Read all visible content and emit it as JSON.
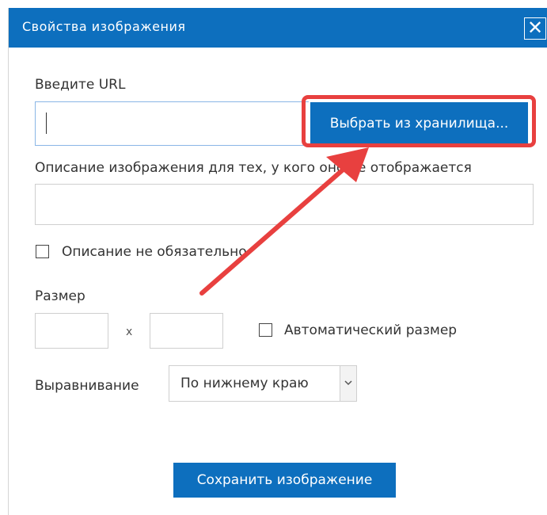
{
  "dialog": {
    "title": "Свойства изображения",
    "close_label": "✕"
  },
  "form": {
    "url_label": "Введите URL",
    "url_value": "",
    "choose_button": "Выбрать из хранилища...",
    "alt_label": "Описание изображения для тех, у кого оно не отображается",
    "alt_value": "",
    "alt_optional_label": "Описание не обязательно",
    "alt_optional_checked": false,
    "size_label": "Размер",
    "width_value": "",
    "times": "x",
    "height_value": "",
    "auto_size_label": "Автоматический размер",
    "auto_size_checked": false,
    "align_label": "Выравнивание",
    "align_value": "По нижнему краю",
    "save_button": "Сохранить изображение"
  },
  "annotation": {
    "color": "#e8403f",
    "type": "arrow-and-highlight"
  },
  "colors": {
    "accent": "#0d6fbe",
    "highlight": "#e8403f"
  }
}
